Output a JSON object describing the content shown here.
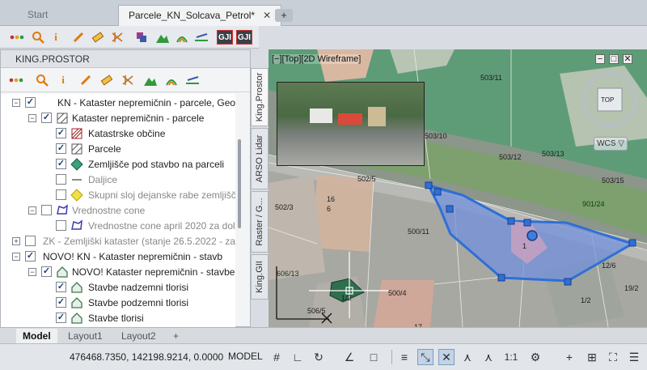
{
  "tabs": {
    "start": "Start",
    "drawing": "Parcele_KN_Solcava_Petrol*",
    "close": "✕",
    "new": "+"
  },
  "toolbar_icons": [
    "layers-dots-icon",
    "search-icon",
    "info-icon",
    "pencil-icon",
    "measure-icon",
    "hatch-icon",
    "stack-icon",
    "terrain-icon",
    "contour-icon",
    "level-icon",
    "gji-icon",
    "gji-alt-icon"
  ],
  "panel": {
    "title": "KING.PROSTOR"
  },
  "tree": [
    {
      "label": "KN - Kataster nepremičnin - parcele, Geod",
      "checked": true,
      "dim": false
    },
    {
      "label": "Kataster nepremičnin - parcele",
      "checked": true,
      "dim": false
    },
    {
      "label": "Katastrske občine",
      "checked": true,
      "dim": false
    },
    {
      "label": "Parcele",
      "checked": true,
      "dim": false
    },
    {
      "label": "Zemljišče pod stavbo na parceli",
      "checked": true,
      "dim": false
    },
    {
      "label": "Daljice",
      "checked": false,
      "dim": true
    },
    {
      "label": "Skupni sloj dejanske rabe zemljišč",
      "checked": false,
      "dim": true
    },
    {
      "label": "Vrednostne cone",
      "checked": false,
      "dim": true
    },
    {
      "label": "Vrednostne cone april 2020 za dolo",
      "checked": false,
      "dim": true
    },
    {
      "label": "ZK - Zemljiški kataster (stanje 26.5.2022 - za a",
      "checked": false,
      "dim": true
    },
    {
      "label": "NOVO! KN - Kataster nepremičnin - stavb",
      "checked": true,
      "dim": false
    },
    {
      "label": "NOVO! Kataster nepremičnin - stavbe",
      "checked": true,
      "dim": false
    },
    {
      "label": "Stavbe nadzemni tlorisi",
      "checked": true,
      "dim": false
    },
    {
      "label": "Stavbe podzemni tlorisi",
      "checked": true,
      "dim": false
    },
    {
      "label": "Stavbe tlorisi",
      "checked": true,
      "dim": false
    }
  ],
  "side_tabs": [
    "King.Prostor",
    "ARSO Lidar",
    "Raster / G...",
    "King.GII"
  ],
  "viewport": {
    "label": "[−][Top][2D Wireframe]",
    "viewcube_top": "TOP",
    "wcs": "WCS ▽",
    "parcels": [
      "503/11",
      "503/10",
      "503/12",
      "503/13",
      "503/15",
      "901/24",
      "502/5",
      "502/3",
      "500/11",
      "16",
      "6",
      "500/4",
      "606/13",
      "506/5",
      "17",
      "1",
      "19/2",
      "1/2",
      "12/6",
      "1/2"
    ],
    "window_ctl": [
      "−",
      "□",
      "✕"
    ]
  },
  "layouts": {
    "model": "Model",
    "layout1": "Layout1",
    "layout2": "Layout2",
    "add": "+"
  },
  "status": {
    "coords": "476468.7350, 142198.9214, 0.0000",
    "model": "MODEL",
    "scale": "1:1"
  },
  "colors": {
    "accent": "#2f6fd6",
    "selection_fill": "#6d8fe0",
    "parcel_green": "#5f9e78"
  }
}
